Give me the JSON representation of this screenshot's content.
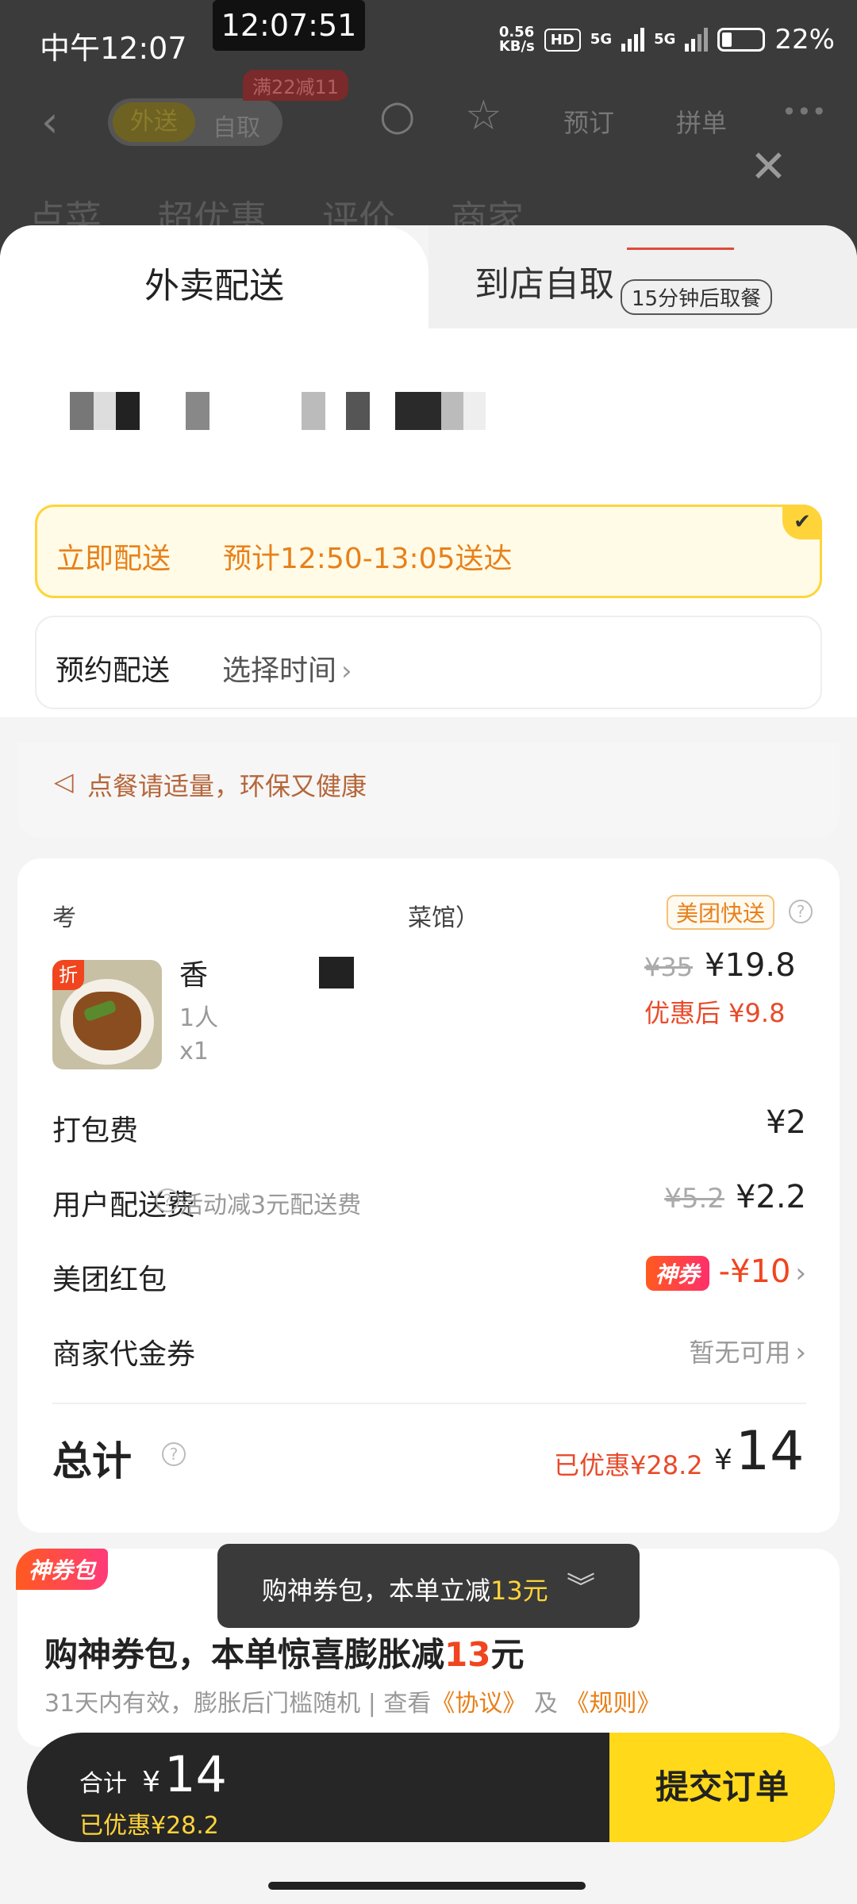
{
  "status_bar": {
    "time": "中午12:07",
    "clock_overlay": "12:07:51",
    "net_speed_top": "0.56",
    "net_speed_unit": "KB/s",
    "hd_badge": "HD",
    "sim1": "5G",
    "sim2": "5G",
    "battery": "22%"
  },
  "header": {
    "seg_delivery": "外送",
    "seg_pickup": "自取",
    "promo_tag": "满22减11",
    "reserve": "预订",
    "group": "拼单",
    "more": "•••",
    "menu": [
      "点菜",
      "超优惠",
      "评价",
      "商家"
    ]
  },
  "tabs": {
    "delivery": "外卖配送",
    "pickup": "到店自取",
    "pickup_badge": "15分钟后取餐"
  },
  "delivery_options": {
    "instant_label": "立即配送",
    "instant_eta": "预计12:50-13:05送达",
    "scheduled_label": "预约配送",
    "scheduled_action": "选择时间"
  },
  "tip": "点餐请适量，环保又健康",
  "order": {
    "shop_name_part1": "考",
    "shop_name_part2": "菜馆）",
    "delivery_badge": "美团快送",
    "item": {
      "badge": "折",
      "title": "香",
      "subtitle": "1人",
      "qty": "x1",
      "price_original": "¥35",
      "price_now": "¥19.8",
      "price_after_discount": "优惠后 ¥9.8"
    },
    "packing_fee_label": "打包费",
    "packing_fee": "¥2",
    "delivery_fee_label": "用户配送费",
    "delivery_fee_hint": "活动减3元配送费",
    "delivery_fee_original": "¥5.2",
    "delivery_fee": "¥2.2",
    "red_packet_label": "美团红包",
    "red_packet_tag": "神券",
    "red_packet_value": "-¥10",
    "voucher_label": "商家代金券",
    "voucher_value": "暂无可用",
    "total_label": "总计",
    "total_saved": "已优惠¥28.2",
    "total_yen": "¥",
    "total_amount": "14"
  },
  "coupon_pack": {
    "tag": "神券包",
    "title_prefix": "购神券包，本单惊喜膨胀减",
    "title_amount": "13",
    "title_suffix": "元",
    "sub_text": "31天内有效，膨胀后门槛随机 | 查看",
    "agreement": "《协议》",
    "and": "及",
    "rules": "《规则》"
  },
  "toast": {
    "prefix": "购神券包，本单立减",
    "amount": "13元"
  },
  "bottom_bar": {
    "label": "合计",
    "yen": "¥",
    "amount": "14",
    "saved": "已优惠¥28.2",
    "submit": "提交订单"
  },
  "colors": {
    "accent_yellow": "#ffd91a",
    "orange": "#e8801a",
    "red": "#e84a2a"
  }
}
